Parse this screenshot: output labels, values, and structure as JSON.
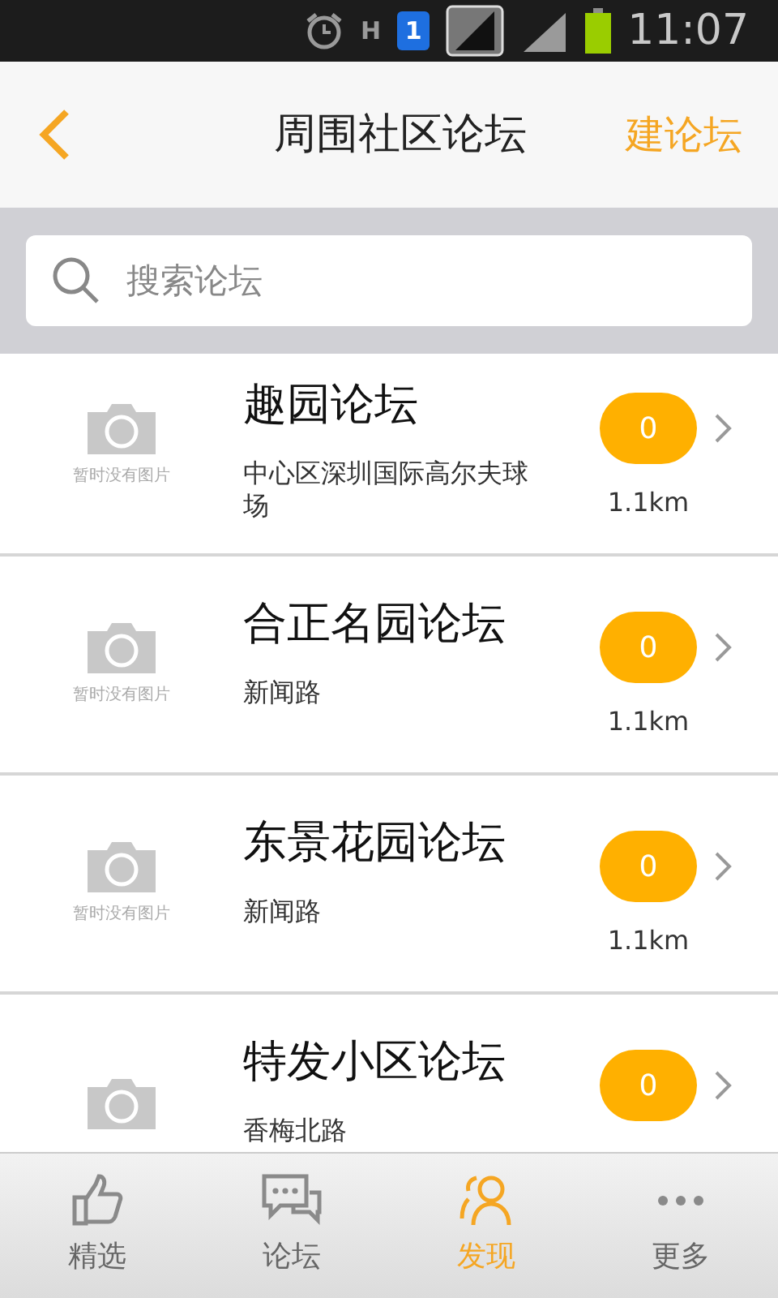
{
  "status_bar": {
    "network_type": "H",
    "sim_slot": "1",
    "time": "11:07"
  },
  "header": {
    "title": "周围社区论坛",
    "action": "建论坛"
  },
  "search": {
    "placeholder": "搜索论坛"
  },
  "forums": [
    {
      "name": "趣园论坛",
      "address": "中心区深圳国际高尔夫球场",
      "no_image_text": "暂时没有图片",
      "count": "0",
      "distance": "1.1km"
    },
    {
      "name": "合正名园论坛",
      "address": "新闻路",
      "no_image_text": "暂时没有图片",
      "count": "0",
      "distance": "1.1km"
    },
    {
      "name": "东景花园论坛",
      "address": "新闻路",
      "no_image_text": "暂时没有图片",
      "count": "0",
      "distance": "1.1km"
    },
    {
      "name": "特发小区论坛",
      "address": "香梅北路",
      "count": "0"
    }
  ],
  "tabs": [
    {
      "kind": "like",
      "label": "精选",
      "selected": false
    },
    {
      "kind": "chat",
      "label": "论坛",
      "selected": false
    },
    {
      "kind": "people",
      "label": "发现",
      "selected": true
    },
    {
      "kind": "more",
      "label": "更多",
      "selected": false
    }
  ]
}
